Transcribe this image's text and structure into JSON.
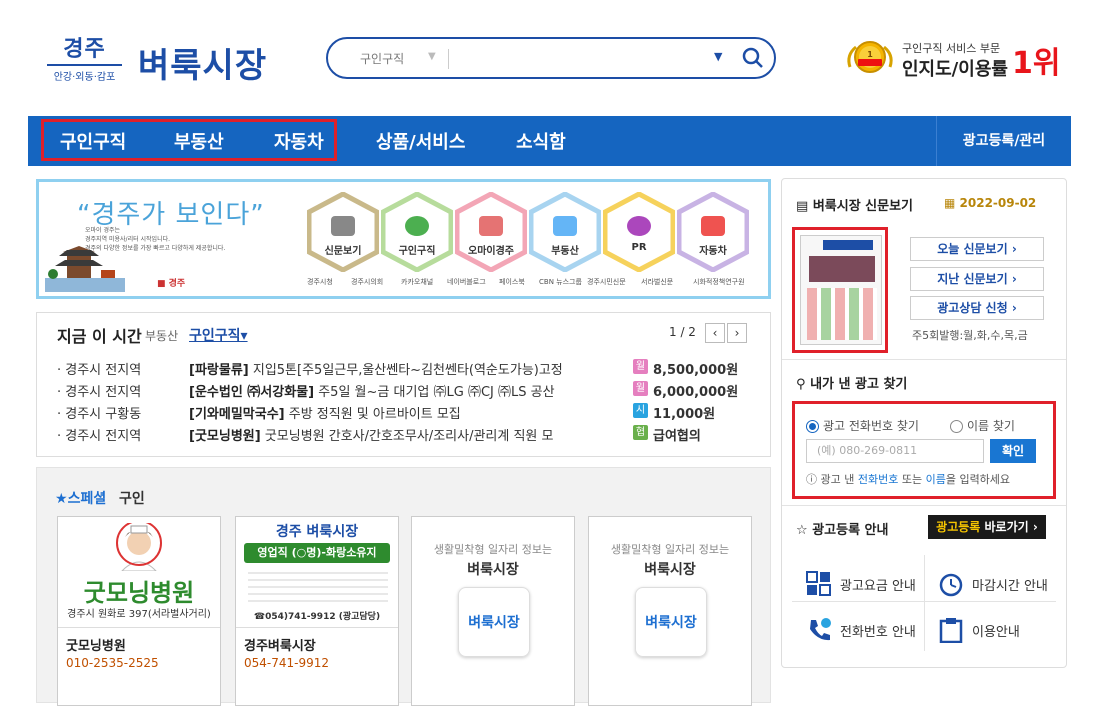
{
  "header": {
    "logo_small_title": "경주",
    "logo_small_sub": "안강·외동·감포",
    "logo_big": "벼룩시장",
    "search_category": "구인구직",
    "award_line1": "구인구직 서비스 부문",
    "award_line2": "인지도/이용률",
    "award_rank": "1위"
  },
  "nav": {
    "items": [
      "구인구직",
      "부동산",
      "자동차",
      "상품/서비스",
      "소식함"
    ],
    "right": "광고등록/관리"
  },
  "banner": {
    "slogan": "“경주가 보인다”",
    "small_lines": [
      "오마이 경주는",
      "경주지역 미용사/리터 시작입니다.",
      "경주의 다양한 정보를 가장 빠르고 다양하게 제공합니다."
    ],
    "hexes": [
      "신문보기",
      "구인구직",
      "오마이경주",
      "부동산",
      "PR",
      "자동차"
    ],
    "footer": [
      "경주시청",
      "경주시의회",
      "카카오채널",
      "네이버블로그",
      "페이스북",
      "CBN 뉴스그룹",
      "경주시민신문",
      "서라벌신문",
      "시화적정책연구원"
    ]
  },
  "now": {
    "title": "지금 이 시간",
    "tab_realestate": "부동산",
    "tab_jobs": "구인구직",
    "page": "1 / 2",
    "rows": [
      {
        "loc": "· 경주시 전지역",
        "company": "[파랑물류]",
        "desc": " 지입5톤[주5일근무,울산쎈타~김천쎈타(역순도가능)고정",
        "pay_type": "월",
        "amount": "8,500,000원"
      },
      {
        "loc": "· 경주시 전지역",
        "company": "[운수법인 ㈜서강화물]",
        "desc": " 주5일 월~금 대기업 ㈜LG ㈜CJ ㈜LS 공산",
        "pay_type": "월",
        "amount": "6,000,000원"
      },
      {
        "loc": "· 경주시 구황동",
        "company": "[기와메밀막국수]",
        "desc": " 주방 정직원 및 아르바이트 모집",
        "pay_type": "시",
        "amount": "11,000원"
      },
      {
        "loc": "· 경주시 전지역",
        "company": "[굿모닝병원]",
        "desc": " 굿모닝병원 간호사/간호조무사/조리사/관리계 직원 모",
        "pay_type": "협",
        "amount": "급여협의"
      }
    ]
  },
  "special": {
    "title": "스페셜",
    "title2": "구인",
    "cards": [
      {
        "img_title": "굿모닝병원",
        "img_sub": "경주시 원화로 397(서라벌사거리)",
        "name": "굿모닝병원",
        "phone": "010-2535-2525"
      },
      {
        "img_title": "경주 벼룩시장",
        "img_band": "영업직 (○명)-화랑소유지",
        "img_phone": "☎054)741-9912 (광고담당)",
        "name": "경주벼룩시장",
        "phone": "054-741-9912"
      },
      {
        "sub": "생활밀착형 일자리 정보는",
        "main": "벼룩시장",
        "box": "벼룩시장"
      },
      {
        "sub": "생활밀착형 일자리 정보는",
        "main": "벼룩시장",
        "box": "벼룩시장"
      }
    ]
  },
  "right": {
    "news_title": "벼룩시장 신문보기",
    "date": "2022-09-02",
    "btn_today": "오늘 신문보기",
    "btn_past": "지난 신문보기",
    "btn_consult": "광고상담 신청",
    "schedule": "주5회발행:월,화,수,목,금",
    "find_title": "내가 낸 광고 찾기",
    "radio_phone": "광고 전화번호 찾기",
    "radio_name": "이름 찾기",
    "phone_placeholder": "(예) 080-269-0811",
    "confirm": "확인",
    "hint_pre": "광고 낸 ",
    "hint_b1": "전화번호",
    "hint_mid": " 또는 ",
    "hint_b2": "이름",
    "hint_post": "을 입력하세요",
    "guide_title": "광고등록 안내",
    "shortcut_y": "광고등록",
    "shortcut_w": " 바로가기",
    "links": [
      "광고요금 안내",
      "마감시간 안내",
      "전화번호 안내",
      "이용안내"
    ]
  },
  "colors": {
    "brand": "#1d4ea6",
    "nav": "#1565c0",
    "highlight": "#e0202a"
  }
}
